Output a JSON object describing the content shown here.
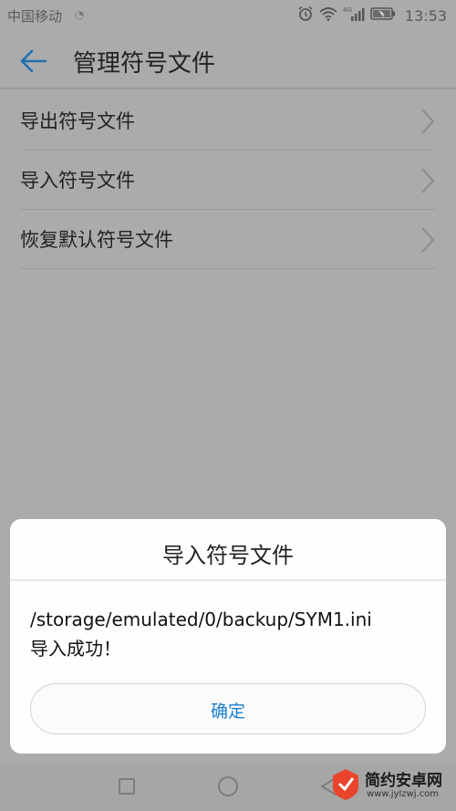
{
  "status_bar": {
    "carrier": "中国移动",
    "network": "4G",
    "time": "13:53"
  },
  "app_bar": {
    "title": "管理符号文件"
  },
  "menu": {
    "items": [
      {
        "label": "导出符号文件"
      },
      {
        "label": "导入符号文件"
      },
      {
        "label": "恢复默认符号文件"
      }
    ]
  },
  "dialog": {
    "title": "导入符号文件",
    "message_line1": "/storage/emulated/0/backup/SYM1.ini",
    "message_line2": "导入成功！",
    "confirm_label": "确定"
  },
  "watermark": {
    "name": "简约安卓网",
    "url": "www.jylzwj.com"
  },
  "colors": {
    "accent": "#1c7fd0",
    "dim_background": "#ababab"
  }
}
